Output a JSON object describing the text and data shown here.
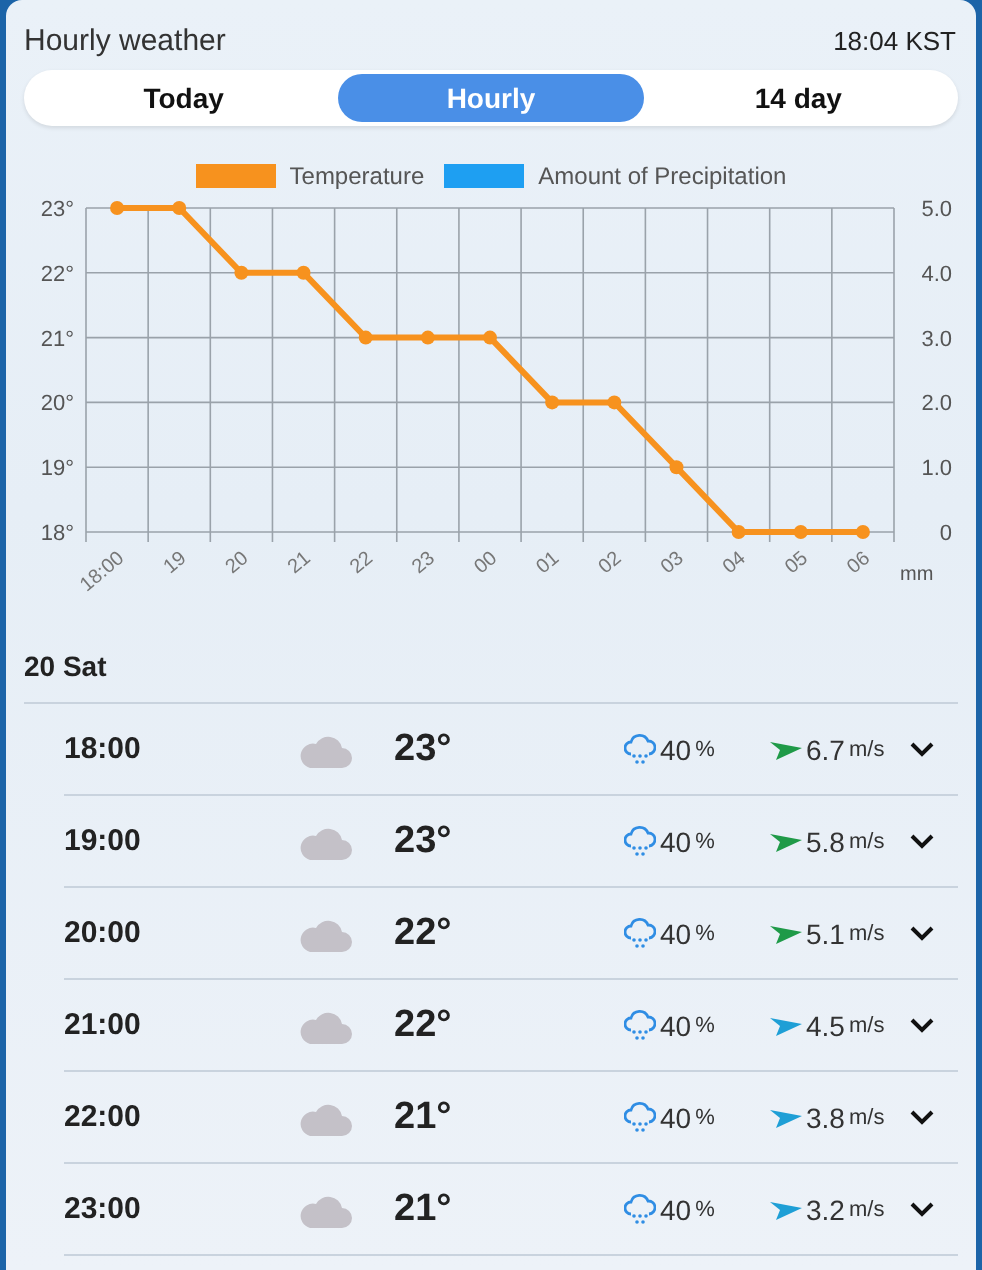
{
  "header": {
    "title": "Hourly weather",
    "time": "18:04 KST"
  },
  "tabs": [
    {
      "label": "Today",
      "selected": false
    },
    {
      "label": "Hourly",
      "selected": true
    },
    {
      "label": "14 day",
      "selected": false
    }
  ],
  "chart_data": {
    "type": "line",
    "categories": [
      "18:00",
      "19",
      "20",
      "21",
      "22",
      "23",
      "00",
      "01",
      "02",
      "03",
      "04",
      "05",
      "06"
    ],
    "series": [
      {
        "name": "Temperature",
        "color": "#f7921e",
        "marker": "circle",
        "values": [
          23,
          23,
          22,
          22,
          21,
          21,
          21,
          20,
          20,
          19,
          18,
          18,
          18
        ]
      },
      {
        "name": "Amount of Precipitation",
        "color": "#1e9ff2",
        "values": [
          null,
          null,
          null,
          null,
          null,
          null,
          null,
          null,
          null,
          null,
          null,
          null,
          null
        ]
      }
    ],
    "ylim": [
      18,
      23
    ],
    "y2lim": [
      0,
      5
    ],
    "grid": true,
    "yticks": [
      {
        "value": 18,
        "label": "18°"
      },
      {
        "value": 19,
        "label": "19°"
      },
      {
        "value": 20,
        "label": "20°"
      },
      {
        "value": 21,
        "label": "21°"
      },
      {
        "value": 22,
        "label": "22°"
      },
      {
        "value": 23,
        "label": "23°"
      }
    ],
    "y2ticks": [
      {
        "value": 0,
        "label": "0"
      },
      {
        "value": 1,
        "label": "1.0"
      },
      {
        "value": 2,
        "label": "2.0"
      },
      {
        "value": 3,
        "label": "3.0"
      },
      {
        "value": 4,
        "label": "4.0"
      },
      {
        "value": 5,
        "label": "5.0"
      }
    ],
    "y2label": "mm"
  },
  "day": "20 Sat",
  "rows": [
    {
      "time": "18:00",
      "temp": "23°",
      "rain": "40",
      "rain_unit": "%",
      "wind": "6.7",
      "wind_unit": "m/s",
      "color": "#1f9a48",
      "expanded": false
    },
    {
      "time": "19:00",
      "temp": "23°",
      "rain": "40",
      "rain_unit": "%",
      "wind": "5.8",
      "wind_unit": "m/s",
      "color": "#1f9a48",
      "expanded": false
    },
    {
      "time": "20:00",
      "temp": "22°",
      "rain": "40",
      "rain_unit": "%",
      "wind": "5.1",
      "wind_unit": "m/s",
      "color": "#1f9a48",
      "expanded": false
    },
    {
      "time": "21:00",
      "temp": "22°",
      "rain": "40",
      "rain_unit": "%",
      "wind": "4.5",
      "wind_unit": "m/s",
      "color": "#1e9fd6",
      "expanded": false
    },
    {
      "time": "22:00",
      "temp": "21°",
      "rain": "40",
      "rain_unit": "%",
      "wind": "3.8",
      "wind_unit": "m/s",
      "color": "#1e9fd6",
      "expanded": false
    },
    {
      "time": "23:00",
      "temp": "21°",
      "rain": "40",
      "rain_unit": "%",
      "wind": "3.2",
      "wind_unit": "m/s",
      "color": "#1e9fd6",
      "expanded": false
    }
  ]
}
